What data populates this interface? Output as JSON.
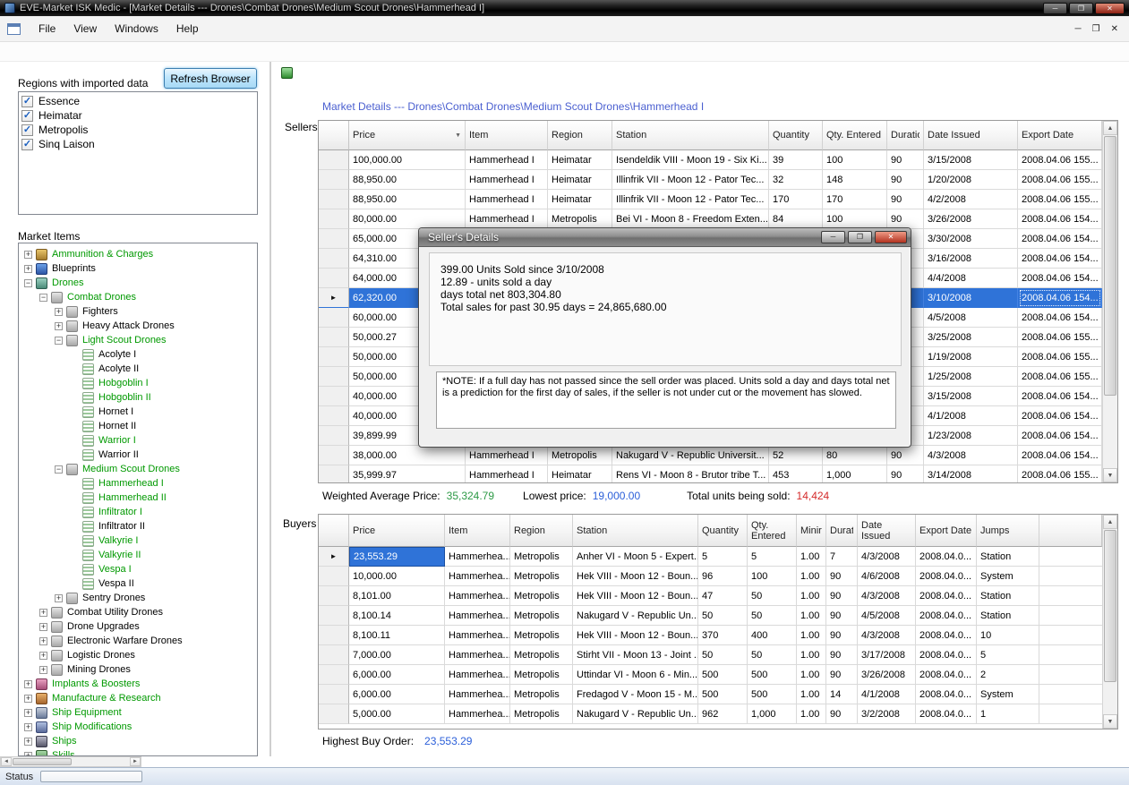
{
  "icons": {
    "minimize": "─",
    "restore": "❐",
    "close": "✕",
    "sort_desc": "▼",
    "current_row": "►",
    "check": "✓",
    "scroll_up": "▲",
    "scroll_down": "▼",
    "scroll_left": "◄",
    "scroll_right": "►",
    "expand_plus": "+",
    "expand_minus": "−"
  },
  "colors": {
    "selection_blue": "#2f73d8",
    "tree_green": "#009900",
    "title_blue": "#4a5fd0",
    "value_green": "#2d9a46",
    "value_blue": "#2b5fd9",
    "value_red": "#d42a2a"
  },
  "titlebar": {
    "title": "EVE-Market ISK Medic - [Market Details --- Drones\\Combat Drones\\Medium Scout Drones\\Hammerhead I]"
  },
  "menubar": {
    "items": [
      "File",
      "View",
      "Windows",
      "Help"
    ]
  },
  "left_panel": {
    "regions_label": "Regions with imported data",
    "refresh_button_label": "Refresh Browser",
    "regions": [
      {
        "label": "Essence",
        "checked": true
      },
      {
        "label": "Heimatar",
        "checked": true
      },
      {
        "label": "Metropolis",
        "checked": true
      },
      {
        "label": "Sinq Laison",
        "checked": true
      }
    ],
    "market_items_label": "Market Items",
    "tree": [
      {
        "label": "Ammunition & Charges",
        "level": 0,
        "expand": "plus",
        "green": true,
        "icon": "ammo"
      },
      {
        "label": "Blueprints",
        "level": 0,
        "expand": "plus",
        "green": false,
        "icon": "blueprint"
      },
      {
        "label": "Drones",
        "level": 0,
        "expand": "minus",
        "green": true,
        "icon": "drones"
      },
      {
        "label": "Combat Drones",
        "level": 1,
        "expand": "minus",
        "green": true,
        "icon": "category"
      },
      {
        "label": "Fighters",
        "level": 2,
        "expand": "plus",
        "green": false,
        "icon": "category"
      },
      {
        "label": "Heavy Attack Drones",
        "level": 2,
        "expand": "plus",
        "green": false,
        "icon": "category"
      },
      {
        "label": "Light Scout Drones",
        "level": 2,
        "expand": "minus",
        "green": true,
        "icon": "category"
      },
      {
        "label": "Acolyte I",
        "level": 3,
        "expand": "",
        "green": false,
        "icon": "item"
      },
      {
        "label": "Acolyte II",
        "level": 3,
        "expand": "",
        "green": false,
        "icon": "item"
      },
      {
        "label": "Hobgoblin I",
        "level": 3,
        "expand": "",
        "green": true,
        "icon": "item"
      },
      {
        "label": "Hobgoblin II",
        "level": 3,
        "expand": "",
        "green": true,
        "icon": "item"
      },
      {
        "label": "Hornet I",
        "level": 3,
        "expand": "",
        "green": false,
        "icon": "item"
      },
      {
        "label": "Hornet II",
        "level": 3,
        "expand": "",
        "green": false,
        "icon": "item"
      },
      {
        "label": "Warrior I",
        "level": 3,
        "expand": "",
        "green": true,
        "icon": "item"
      },
      {
        "label": "Warrior II",
        "level": 3,
        "expand": "",
        "green": false,
        "icon": "item"
      },
      {
        "label": "Medium Scout Drones",
        "level": 2,
        "expand": "minus",
        "green": true,
        "icon": "category"
      },
      {
        "label": "Hammerhead I",
        "level": 3,
        "expand": "",
        "green": true,
        "icon": "item"
      },
      {
        "label": "Hammerhead II",
        "level": 3,
        "expand": "",
        "green": true,
        "icon": "item"
      },
      {
        "label": "Infiltrator I",
        "level": 3,
        "expand": "",
        "green": true,
        "icon": "item"
      },
      {
        "label": "Infiltrator II",
        "level": 3,
        "expand": "",
        "green": false,
        "icon": "item"
      },
      {
        "label": "Valkyrie I",
        "level": 3,
        "expand": "",
        "green": true,
        "icon": "item"
      },
      {
        "label": "Valkyrie II",
        "level": 3,
        "expand": "",
        "green": true,
        "icon": "item"
      },
      {
        "label": "Vespa I",
        "level": 3,
        "expand": "",
        "green": true,
        "icon": "item"
      },
      {
        "label": "Vespa II",
        "level": 3,
        "expand": "",
        "green": false,
        "icon": "item"
      },
      {
        "label": "Sentry Drones",
        "level": 2,
        "expand": "plus",
        "green": false,
        "icon": "category"
      },
      {
        "label": "Combat Utility Drones",
        "level": 1,
        "expand": "plus",
        "green": false,
        "icon": "category"
      },
      {
        "label": "Drone Upgrades",
        "level": 1,
        "expand": "plus",
        "green": false,
        "icon": "category"
      },
      {
        "label": "Electronic Warfare Drones",
        "level": 1,
        "expand": "plus",
        "green": false,
        "icon": "category"
      },
      {
        "label": "Logistic Drones",
        "level": 1,
        "expand": "plus",
        "green": false,
        "icon": "category"
      },
      {
        "label": "Mining Drones",
        "level": 1,
        "expand": "plus",
        "green": false,
        "icon": "category"
      },
      {
        "label": "Implants & Boosters",
        "level": 0,
        "expand": "plus",
        "green": true,
        "icon": "implants"
      },
      {
        "label": "Manufacture & Research",
        "level": 0,
        "expand": "plus",
        "green": true,
        "icon": "manufacture"
      },
      {
        "label": "Ship Equipment",
        "level": 0,
        "expand": "plus",
        "green": true,
        "icon": "equipment"
      },
      {
        "label": "Ship Modifications",
        "level": 0,
        "expand": "plus",
        "green": true,
        "icon": "modifications"
      },
      {
        "label": "Ships",
        "level": 0,
        "expand": "plus",
        "green": true,
        "icon": "ships"
      },
      {
        "label": "Skills",
        "level": 0,
        "expand": "plus",
        "green": true,
        "icon": "skills"
      }
    ]
  },
  "market_details": {
    "title": "Market Details --- Drones\\Combat Drones\\Medium Scout Drones\\Hammerhead I",
    "sellers_label": "Sellers",
    "buyers_label": "Buyers",
    "sellers_grid": {
      "columns": [
        "Price",
        "Item",
        "Region",
        "Station",
        "Quantity",
        "Qty. Entered",
        "Duration",
        "Date Issued",
        "Export Date"
      ],
      "rows": [
        {
          "price": "100,000.00",
          "item": "Hammerhead I",
          "region": "Heimatar",
          "station": "Isendeldik VIII - Moon 19 - Six Ki...",
          "qty": "39",
          "qty_entered": "100",
          "duration": "90",
          "date_issued": "3/15/2008",
          "export_date": "2008.04.06 155..."
        },
        {
          "price": "88,950.00",
          "item": "Hammerhead I",
          "region": "Heimatar",
          "station": "Illinfrik VII - Moon 12 - Pator Tec...",
          "qty": "32",
          "qty_entered": "148",
          "duration": "90",
          "date_issued": "1/20/2008",
          "export_date": "2008.04.06 155..."
        },
        {
          "price": "88,950.00",
          "item": "Hammerhead I",
          "region": "Heimatar",
          "station": "Illinfrik VII - Moon 12 - Pator Tec...",
          "qty": "170",
          "qty_entered": "170",
          "duration": "90",
          "date_issued": "4/2/2008",
          "export_date": "2008.04.06 155..."
        },
        {
          "price": "80,000.00",
          "item": "Hammerhead I",
          "region": "Metropolis",
          "station": "Bei VI - Moon 8 - Freedom Exten...",
          "qty": "84",
          "qty_entered": "100",
          "duration": "90",
          "date_issued": "3/26/2008",
          "export_date": "2008.04.06 154..."
        },
        {
          "price": "65,000.00",
          "item": "",
          "region": "",
          "station": "",
          "qty": "",
          "qty_entered": "",
          "duration": "",
          "date_issued": "3/30/2008",
          "export_date": "2008.04.06 154..."
        },
        {
          "price": "64,310.00",
          "item": "",
          "region": "",
          "station": "",
          "qty": "",
          "qty_entered": "",
          "duration": "",
          "date_issued": "3/16/2008",
          "export_date": "2008.04.06 154..."
        },
        {
          "price": "64,000.00",
          "item": "",
          "region": "",
          "station": "",
          "qty": "",
          "qty_entered": "",
          "duration": "",
          "date_issued": "4/4/2008",
          "export_date": "2008.04.06 154..."
        },
        {
          "price": "62,320.00",
          "item": "",
          "region": "",
          "station": "",
          "qty": "",
          "qty_entered": "",
          "duration": "",
          "date_issued": "3/10/2008",
          "export_date": "2008.04.06 154...",
          "selected": true,
          "current": true
        },
        {
          "price": "60,000.00",
          "item": "",
          "region": "",
          "station": "",
          "qty": "",
          "qty_entered": "",
          "duration": "",
          "date_issued": "4/5/2008",
          "export_date": "2008.04.06 154..."
        },
        {
          "price": "50,000.27",
          "item": "",
          "region": "",
          "station": "",
          "qty": "",
          "qty_entered": "",
          "duration": "",
          "date_issued": "3/25/2008",
          "export_date": "2008.04.06 155..."
        },
        {
          "price": "50,000.00",
          "item": "",
          "region": "",
          "station": "",
          "qty": "",
          "qty_entered": "",
          "duration": "",
          "date_issued": "1/19/2008",
          "export_date": "2008.04.06 155..."
        },
        {
          "price": "50,000.00",
          "item": "",
          "region": "",
          "station": "",
          "qty": "",
          "qty_entered": "",
          "duration": "",
          "date_issued": "1/25/2008",
          "export_date": "2008.04.06 155..."
        },
        {
          "price": "40,000.00",
          "item": "",
          "region": "",
          "station": "",
          "qty": "",
          "qty_entered": "",
          "duration": "",
          "date_issued": "3/15/2008",
          "export_date": "2008.04.06 154..."
        },
        {
          "price": "40,000.00",
          "item": "",
          "region": "",
          "station": "",
          "qty": "",
          "qty_entered": "",
          "duration": "",
          "date_issued": "4/1/2008",
          "export_date": "2008.04.06 154..."
        },
        {
          "price": "39,899.99",
          "item": "",
          "region": "",
          "station": "",
          "qty": "",
          "qty_entered": "",
          "duration": "",
          "date_issued": "1/23/2008",
          "export_date": "2008.04.06 154..."
        },
        {
          "price": "38,000.00",
          "item": "Hammerhead I",
          "region": "Metropolis",
          "station": "Nakugard V - Republic Universit...",
          "qty": "52",
          "qty_entered": "80",
          "duration": "90",
          "date_issued": "4/3/2008",
          "export_date": "2008.04.06 154..."
        },
        {
          "price": "35,999.97",
          "item": "Hammerhead I",
          "region": "Heimatar",
          "station": "Rens VI - Moon 8 - Brutor tribe T...",
          "qty": "453",
          "qty_entered": "1,000",
          "duration": "90",
          "date_issued": "3/14/2008",
          "export_date": "2008.04.06 155..."
        }
      ]
    },
    "summary": {
      "weighted_avg_label": "Weighted Average Price:",
      "weighted_avg_value": "35,324.79",
      "lowest_label": "Lowest price:",
      "lowest_value": "19,000.00",
      "total_units_label": "Total units being sold:",
      "total_units_value": "14,424"
    },
    "buyers_grid": {
      "columns": [
        "Price",
        "Item",
        "Region",
        "Station",
        "Quantity",
        "Qty. Entered",
        "Minir",
        "Durat",
        "Date Issued",
        "Export Date",
        "Jumps"
      ],
      "rows": [
        {
          "price": "23,553.29",
          "item": "Hammerhea...",
          "region": "Metropolis",
          "station": "Anher VI - Moon 5 - Expert...",
          "qty": "5",
          "qty_entered": "5",
          "min": "1.00",
          "dur": "7",
          "date_issued": "4/3/2008",
          "export_date": "2008.04.0...",
          "jumps": "Station",
          "selected_cell": true,
          "current": true
        },
        {
          "price": "10,000.00",
          "item": "Hammerhea...",
          "region": "Metropolis",
          "station": "Hek VIII - Moon 12 - Boun...",
          "qty": "96",
          "qty_entered": "100",
          "min": "1.00",
          "dur": "90",
          "date_issued": "4/6/2008",
          "export_date": "2008.04.0...",
          "jumps": "System"
        },
        {
          "price": "8,101.00",
          "item": "Hammerhea...",
          "region": "Metropolis",
          "station": "Hek VIII - Moon 12 - Boun...",
          "qty": "47",
          "qty_entered": "50",
          "min": "1.00",
          "dur": "90",
          "date_issued": "4/3/2008",
          "export_date": "2008.04.0...",
          "jumps": "Station"
        },
        {
          "price": "8,100.14",
          "item": "Hammerhea...",
          "region": "Metropolis",
          "station": "Nakugard V - Republic Un...",
          "qty": "50",
          "qty_entered": "50",
          "min": "1.00",
          "dur": "90",
          "date_issued": "4/5/2008",
          "export_date": "2008.04.0...",
          "jumps": "Station"
        },
        {
          "price": "8,100.11",
          "item": "Hammerhea...",
          "region": "Metropolis",
          "station": "Hek VIII - Moon 12 - Boun...",
          "qty": "370",
          "qty_entered": "400",
          "min": "1.00",
          "dur": "90",
          "date_issued": "4/3/2008",
          "export_date": "2008.04.0...",
          "jumps": "10"
        },
        {
          "price": "7,000.00",
          "item": "Hammerhea...",
          "region": "Metropolis",
          "station": "Stirht VII - Moon 13 - Joint ...",
          "qty": "50",
          "qty_entered": "50",
          "min": "1.00",
          "dur": "90",
          "date_issued": "3/17/2008",
          "export_date": "2008.04.0...",
          "jumps": "5"
        },
        {
          "price": "6,000.00",
          "item": "Hammerhea...",
          "region": "Metropolis",
          "station": "Uttindar VI - Moon 6 - Min...",
          "qty": "500",
          "qty_entered": "500",
          "min": "1.00",
          "dur": "90",
          "date_issued": "3/26/2008",
          "export_date": "2008.04.0...",
          "jumps": "2"
        },
        {
          "price": "6,000.00",
          "item": "Hammerhea...",
          "region": "Metropolis",
          "station": "Fredagod V - Moon 15 - M...",
          "qty": "500",
          "qty_entered": "500",
          "min": "1.00",
          "dur": "14",
          "date_issued": "4/1/2008",
          "export_date": "2008.04.0...",
          "jumps": "System"
        },
        {
          "price": "5,000.00",
          "item": "Hammerhea...",
          "region": "Metropolis",
          "station": "Nakugard V - Republic Un...",
          "qty": "962",
          "qty_entered": "1,000",
          "min": "1.00",
          "dur": "90",
          "date_issued": "3/2/2008",
          "export_date": "2008.04.0...",
          "jumps": "1"
        }
      ]
    },
    "highest_label": "Highest Buy Order:",
    "highest_value": "23,553.29"
  },
  "dialog": {
    "title": "Seller's Details",
    "lines": [
      "399.00 Units Sold since 3/10/2008",
      "12.89 - units sold a day",
      "days total net 803,304.80",
      "Total sales for past 30.95 days = 24,865,680.00"
    ],
    "note": "*NOTE: If a full day has not passed since the sell order was placed. Units sold a day and  days total net is a prediction for the first day of sales, if the seller is not under cut or the movement has slowed."
  },
  "statusbar": {
    "label": "Status"
  }
}
